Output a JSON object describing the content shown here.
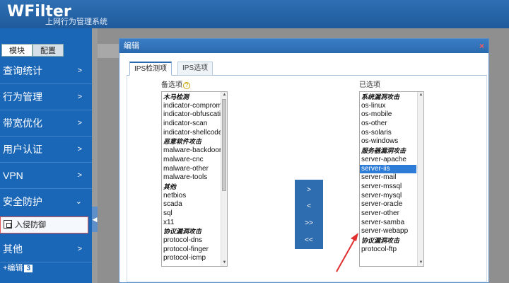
{
  "header": {
    "brand": "WFilter",
    "subtitle": "上网行为管理系统"
  },
  "sidebar": {
    "tabs": [
      "模块",
      "配置"
    ],
    "menu": [
      {
        "label": "查询统计",
        "chev": ">"
      },
      {
        "label": "行为管理",
        "chev": ">"
      },
      {
        "label": "带宽优化",
        "chev": ">"
      },
      {
        "label": "用户认证",
        "chev": ">"
      },
      {
        "label": "VPN",
        "chev": ">"
      },
      {
        "label": "安全防护",
        "chev": "⌄"
      }
    ],
    "subitem": "入侵防御",
    "menu_after": {
      "label": "其他",
      "chev": ">"
    },
    "footer": {
      "label": "+编辑",
      "badge": "3"
    }
  },
  "dialog": {
    "title": "编辑",
    "close": "×",
    "tabs": [
      "IPS检测项",
      "IPS选项"
    ],
    "available_label": "备选项",
    "available_help": "?",
    "selected_label": "已选项",
    "available": [
      {
        "text": "木马检测",
        "group": true
      },
      {
        "text": "indicator-compromise",
        "group": false
      },
      {
        "text": "indicator-obfuscation",
        "group": false
      },
      {
        "text": "indicator-scan",
        "group": false
      },
      {
        "text": "indicator-shellcode",
        "group": false
      },
      {
        "text": "恶意软件攻击",
        "group": true
      },
      {
        "text": "malware-backdoor",
        "group": false
      },
      {
        "text": "malware-cnc",
        "group": false
      },
      {
        "text": "malware-other",
        "group": false
      },
      {
        "text": "malware-tools",
        "group": false
      },
      {
        "text": "其他",
        "group": true
      },
      {
        "text": "netbios",
        "group": false
      },
      {
        "text": "scada",
        "group": false
      },
      {
        "text": "sql",
        "group": false
      },
      {
        "text": "x11",
        "group": false
      },
      {
        "text": "协议漏洞攻击",
        "group": true
      },
      {
        "text": "protocol-dns",
        "group": false
      },
      {
        "text": "protocol-finger",
        "group": false
      },
      {
        "text": "protocol-icmp",
        "group": false
      }
    ],
    "selected": [
      {
        "text": "系统漏洞攻击",
        "group": true,
        "sel": false
      },
      {
        "text": "os-linux",
        "group": false,
        "sel": false
      },
      {
        "text": "os-mobile",
        "group": false,
        "sel": false
      },
      {
        "text": "os-other",
        "group": false,
        "sel": false
      },
      {
        "text": "os-solaris",
        "group": false,
        "sel": false
      },
      {
        "text": "os-windows",
        "group": false,
        "sel": false
      },
      {
        "text": "服务器漏洞攻击",
        "group": true,
        "sel": false
      },
      {
        "text": "server-apache",
        "group": false,
        "sel": false
      },
      {
        "text": "server-iis",
        "group": false,
        "sel": true
      },
      {
        "text": "server-mail",
        "group": false,
        "sel": false
      },
      {
        "text": "server-mssql",
        "group": false,
        "sel": false
      },
      {
        "text": "server-mysql",
        "group": false,
        "sel": false
      },
      {
        "text": "server-oracle",
        "group": false,
        "sel": false
      },
      {
        "text": "server-other",
        "group": false,
        "sel": false
      },
      {
        "text": "server-samba",
        "group": false,
        "sel": false
      },
      {
        "text": "server-webapp",
        "group": false,
        "sel": false
      },
      {
        "text": "协议漏洞攻击",
        "group": true,
        "sel": false
      },
      {
        "text": "protocol-ftp",
        "group": false,
        "sel": false
      }
    ],
    "buttons": [
      ">",
      "<",
      ">>",
      "<<"
    ]
  },
  "colors": {
    "accent": "#1a67b8",
    "selection": "#2d7cd8",
    "annotation": "#e03030"
  }
}
